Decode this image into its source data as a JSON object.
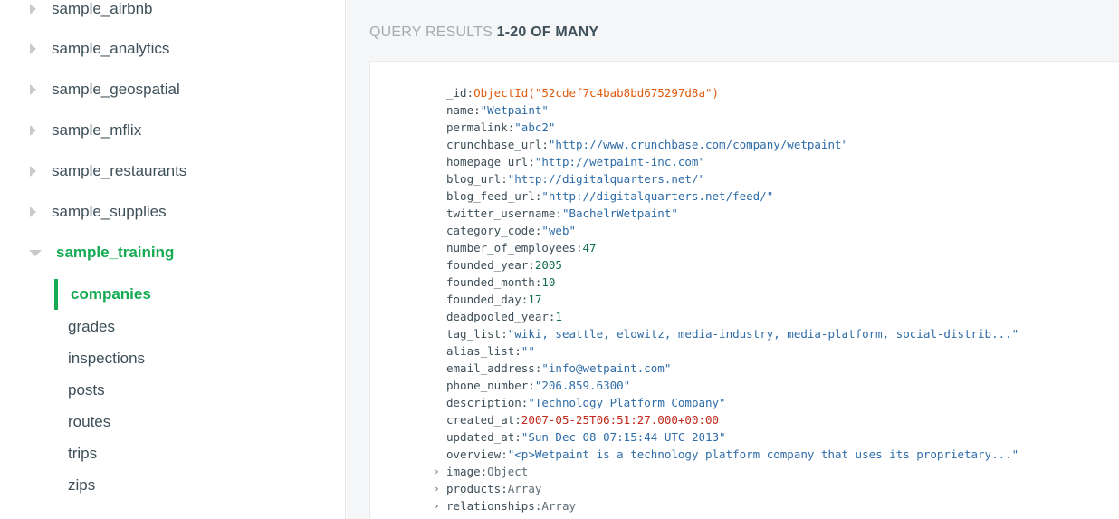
{
  "sidebar": {
    "databases": [
      {
        "label": "sample_airbnb",
        "expanded": false
      },
      {
        "label": "sample_analytics",
        "expanded": false
      },
      {
        "label": "sample_geospatial",
        "expanded": false
      },
      {
        "label": "sample_mflix",
        "expanded": false
      },
      {
        "label": "sample_restaurants",
        "expanded": false
      },
      {
        "label": "sample_supplies",
        "expanded": false
      },
      {
        "label": "sample_training",
        "expanded": true
      }
    ],
    "collections": [
      {
        "label": "companies",
        "active": true
      },
      {
        "label": "grades"
      },
      {
        "label": "inspections"
      },
      {
        "label": "posts"
      },
      {
        "label": "routes"
      },
      {
        "label": "trips"
      },
      {
        "label": "zips"
      }
    ]
  },
  "results": {
    "title": "QUERY RESULTS",
    "range": "1-20 OF MANY"
  },
  "document": {
    "fields": [
      {
        "key": "_id",
        "value": "ObjectId(\"52cdef7c4bab8bd675297d8a\")",
        "type": "objectid"
      },
      {
        "key": "name",
        "value": "\"Wetpaint\"",
        "type": "string"
      },
      {
        "key": "permalink",
        "value": "\"abc2\"",
        "type": "string"
      },
      {
        "key": "crunchbase_url",
        "value": "\"http://www.crunchbase.com/company/wetpaint\"",
        "type": "string"
      },
      {
        "key": "homepage_url",
        "value": "\"http://wetpaint-inc.com\"",
        "type": "string"
      },
      {
        "key": "blog_url",
        "value": "\"http://digitalquarters.net/\"",
        "type": "string"
      },
      {
        "key": "blog_feed_url",
        "value": "\"http://digitalquarters.net/feed/\"",
        "type": "string"
      },
      {
        "key": "twitter_username",
        "value": "\"BachelrWetpaint\"",
        "type": "string"
      },
      {
        "key": "category_code",
        "value": "\"web\"",
        "type": "string"
      },
      {
        "key": "number_of_employees",
        "value": "47",
        "type": "number"
      },
      {
        "key": "founded_year",
        "value": "2005",
        "type": "number"
      },
      {
        "key": "founded_month",
        "value": "10",
        "type": "number"
      },
      {
        "key": "founded_day",
        "value": "17",
        "type": "number"
      },
      {
        "key": "deadpooled_year",
        "value": "1",
        "type": "number"
      },
      {
        "key": "tag_list",
        "value": "\"wiki, seattle, elowitz, media-industry, media-platform, social-distrib...\"",
        "type": "string"
      },
      {
        "key": "alias_list",
        "value": "\"\"",
        "type": "string"
      },
      {
        "key": "email_address",
        "value": "\"info@wetpaint.com\"",
        "type": "string"
      },
      {
        "key": "phone_number",
        "value": "\"206.859.6300\"",
        "type": "string"
      },
      {
        "key": "description",
        "value": "\"Technology Platform Company\"",
        "type": "string"
      },
      {
        "key": "created_at",
        "value": "2007-05-25T06:51:27.000+00:00",
        "type": "date"
      },
      {
        "key": "updated_at",
        "value": "\"Sun Dec 08 07:15:44 UTC 2013\"",
        "type": "string"
      },
      {
        "key": "overview",
        "value": "\"<p>Wetpaint is a technology platform company that uses its proprietary...\"",
        "type": "string"
      },
      {
        "key": "image",
        "value": "Object",
        "type": "type",
        "expandable": true
      },
      {
        "key": "products",
        "value": "Array",
        "type": "type",
        "expandable": true
      },
      {
        "key": "relationships",
        "value": "Array",
        "type": "type",
        "expandable": true
      }
    ]
  },
  "icons": {
    "caret_right": "caret-right-icon",
    "caret_down": "caret-down-icon",
    "expand": "chevron-right-icon"
  },
  "colors": {
    "accent": "#13aa52",
    "objectid": "#e05a0c",
    "string": "#2e6ca8",
    "number": "#116f4b",
    "date": "#c0291c"
  }
}
